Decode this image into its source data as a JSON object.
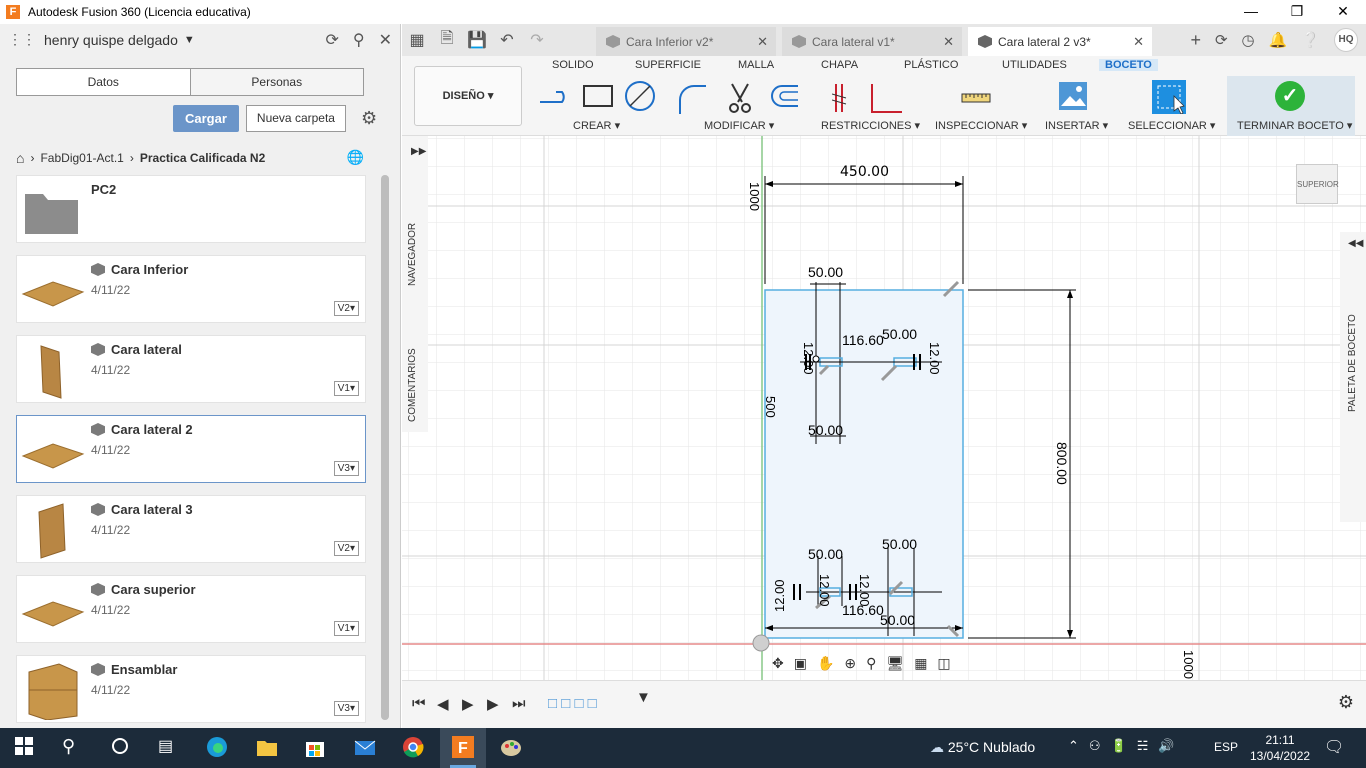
{
  "window": {
    "title": "Autodesk Fusion 360 (Licencia educativa)"
  },
  "datapanel": {
    "user": "henry quispe delgado",
    "tabs": [
      "Datos",
      "Personas"
    ],
    "upload_label": "Cargar",
    "new_folder_label": "Nueva carpeta",
    "breadcrumb": [
      "FabDig01-Act.1",
      "Practica Calificada N2"
    ],
    "folder_name": "PC2",
    "files": [
      {
        "name": "Cara Inferior",
        "date": "4/11/22",
        "version": "V2"
      },
      {
        "name": "Cara lateral",
        "date": "4/11/22",
        "version": "V1"
      },
      {
        "name": "Cara lateral 2",
        "date": "4/11/22",
        "version": "V3"
      },
      {
        "name": "Cara lateral 3",
        "date": "4/11/22",
        "version": "V2"
      },
      {
        "name": "Cara superior",
        "date": "4/11/22",
        "version": "V1"
      },
      {
        "name": "Ensamblar",
        "date": "4/11/22",
        "version": "V3"
      }
    ]
  },
  "doc_tabs": [
    {
      "label": "Cara Inferior v2*"
    },
    {
      "label": "Cara lateral v1*"
    },
    {
      "label": "Cara lateral 2 v3*"
    }
  ],
  "user_initials": "HQ",
  "toolbar": {
    "workspace": "DISEÑO",
    "tabs": [
      "SOLIDO",
      "SUPERFICIE",
      "MALLA",
      "CHAPA",
      "PLÁSTICO",
      "UTILIDADES",
      "BOCETO"
    ],
    "groups": [
      "CREAR",
      "MODIFICAR",
      "RESTRICCIONES",
      "INSPECCIONAR",
      "INSERTAR",
      "SELECCIONAR",
      "TERMINAR BOCETO"
    ]
  },
  "canvas": {
    "browser_label": "NAVEGADOR",
    "comments_label": "COMENTARIOS",
    "palette_label": "PALETA DE BOCETO",
    "viewcube_label": "SUPERIOR",
    "dimensions": {
      "d_top_width": "450.00",
      "d_tick_top": "1000",
      "d_left_500": "500",
      "d_right_800": "800.00",
      "d_upper_50a": "50.00",
      "d_upper_116": "116.60",
      "d_upper_50b": "50.00",
      "d_upper_12a": "12.00",
      "d_upper_12b": "12.00",
      "d_upper_50c": "50.00",
      "d_lower_50a": "50.00",
      "d_lower_50b": "50.00",
      "d_lower_12a": "12.00",
      "d_lower_12b": "12.00",
      "d_lower_12c": "12.00",
      "d_lower_116": "116.60",
      "d_lower_50c": "50.00",
      "d_bottom_1000": "1000"
    }
  },
  "taskbar": {
    "weather": "25°C  Nublado",
    "lang": "ESP",
    "time": "21:11",
    "date": "13/04/2022"
  },
  "colors": {
    "accent": "#1e6fc8",
    "sketch_line": "#56aee0",
    "sketch_fill": "#eef5fc",
    "taskbar": "#1c2b3a",
    "finish_green": "#2db33a"
  }
}
